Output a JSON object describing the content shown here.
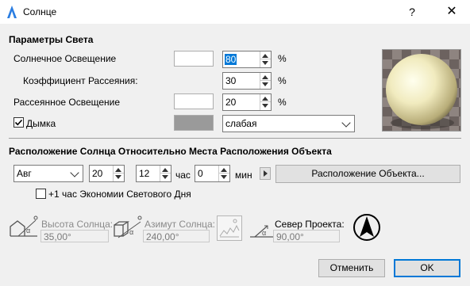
{
  "window": {
    "title": "Солнце",
    "help": "?",
    "close": "✕"
  },
  "light": {
    "section": "Параметры Света",
    "sun_label": "Солнечное Освещение",
    "sun_value": "80",
    "scatter_label": "Коэффициент Рассеяния:",
    "scatter_value": "30",
    "ambient_label": "Рассеянное Освещение",
    "ambient_value": "20",
    "percent": "%",
    "haze_label": "Дымка",
    "haze_checked": true,
    "haze_value": "слабая",
    "haze_color": "#9a9a9a"
  },
  "position": {
    "section": "Расположение Солнца Относительно Места Расположения Объекта",
    "month": "Авг",
    "day": "20",
    "hour": "12",
    "hour_unit": "час",
    "minute": "0",
    "minute_unit": "мин",
    "location_button": "Расположение Объекта...",
    "dst_label": "+1 час Экономии Светового Дня",
    "dst_checked": false
  },
  "readouts": {
    "altitude_label": "Высота Солнца:",
    "altitude_value": "35,00°",
    "azimuth_label": "Азимут Солнца:",
    "azimuth_value": "240,00°",
    "north_label": "Север Проекта:",
    "north_value": "90,00°"
  },
  "footer": {
    "cancel": "Отменить",
    "ok": "OK"
  },
  "colors": {
    "preview_sphere": "#f1ebbf",
    "selection": "#0078d7"
  }
}
